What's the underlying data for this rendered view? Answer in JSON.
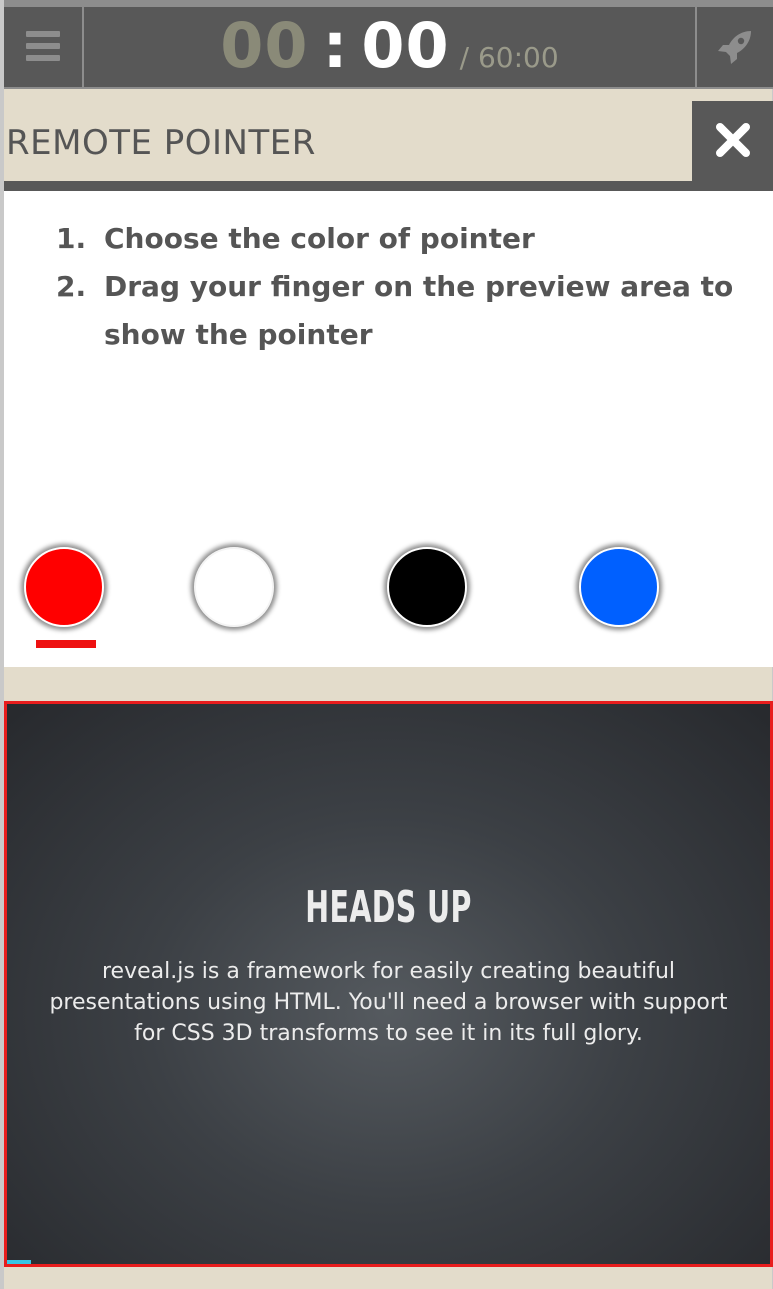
{
  "timer": {
    "minutes": "00",
    "separator": ":",
    "seconds": "00",
    "total": "/ 60:00"
  },
  "icons": {
    "menu": "hamburger-icon",
    "launch": "rocket-icon",
    "close": "close-icon"
  },
  "header": {
    "title": "REMOTE POINTER"
  },
  "instructions": [
    {
      "num": "1.",
      "text": "Choose the color of pointer"
    },
    {
      "num": "2.",
      "text": "Drag your finger on the preview area to show the pointer"
    }
  ],
  "pointer_colors": {
    "options": [
      "#ff0000",
      "#ffffff",
      "#000000",
      "#0060ff"
    ],
    "selected": "#ff0000"
  },
  "slide": {
    "title": "HEADS UP",
    "body": "reveal.js is a framework for easily creating beautiful presentations using HTML. You'll need a browser with support for CSS 3D transforms to see it in its full glory."
  },
  "colors": {
    "accent": "#e81d1d",
    "topbar": "#585858",
    "header_bg": "#e3dccb",
    "progress": "#38c5e6"
  }
}
